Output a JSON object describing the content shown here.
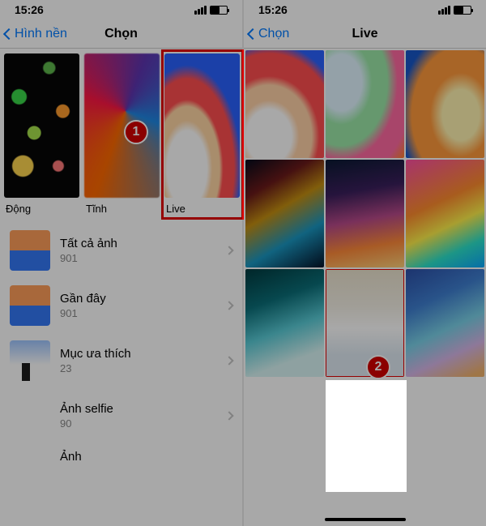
{
  "callouts": {
    "one": "1",
    "two": "2"
  },
  "left": {
    "status_time": "15:26",
    "back_label": "Hình nền",
    "nav_title": "Chọn",
    "categories": [
      {
        "label": "Động"
      },
      {
        "label": "Tĩnh"
      },
      {
        "label": "Live"
      }
    ],
    "albums": [
      {
        "title": "Tất cả ảnh",
        "count": "901"
      },
      {
        "title": "Gần đây",
        "count": "901"
      },
      {
        "title": "Mục ưa thích",
        "count": "23"
      },
      {
        "title": "Ảnh selfie",
        "count": "90"
      },
      {
        "title": "Ảnh",
        "count": ""
      }
    ]
  },
  "right": {
    "status_time": "15:26",
    "back_label": "Chọn",
    "nav_title": "Live"
  }
}
